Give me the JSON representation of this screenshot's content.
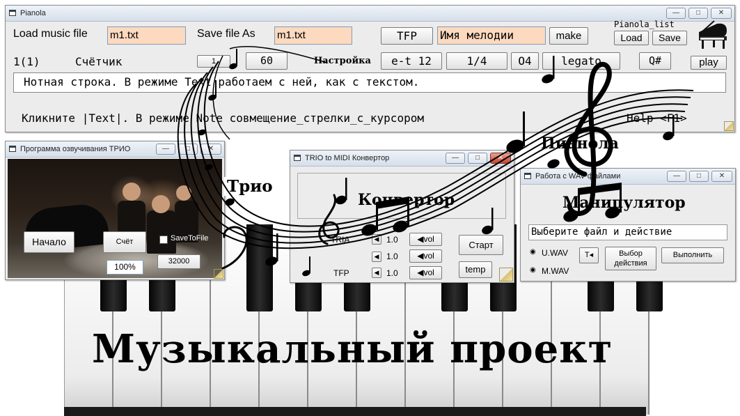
{
  "headline": "Музыкальный  проект",
  "pianola": {
    "title": "Pianola",
    "load_label": "Load music file",
    "load_value": "m1.txt",
    "save_label": "Save file As",
    "save_value": "m1.txt",
    "tfp_button": "TFP",
    "melody_name": "Имя мелодии",
    "make_button": "make",
    "pianola_list_label": "Pianola_list",
    "list_load": "Load",
    "list_save": "Save",
    "counter_text": "1(1)",
    "counter_label": "Счётчик",
    "counter_value": "1",
    "bpm_value": "60",
    "settings_label": "Настройка",
    "key_value": "e-t 12",
    "fraction_value": "1/4",
    "octave_value": "O4",
    "legato_value": "legato",
    "sharp_value": "Q#",
    "play_button": "play",
    "note_string": "Нотная строка. В режиме Text работаем с ней, как с текстом.",
    "hint_text": "Кликните |Text|. В режиме Note совмещение_стрелки_с_курсором",
    "help_text": "Help <F1>"
  },
  "trio": {
    "title": "Программа озвучивания ТРИО",
    "start_button": "Начало",
    "count_button": "Счёт",
    "save_to_file": "SaveToFile",
    "percent_value": "100%",
    "rate_value": "32000",
    "label": "Трио"
  },
  "converter": {
    "title": "TRIO to MIDI  Конвертор",
    "heading": "Конвертор",
    "row1_label": "TRIA",
    "row1_value": "1.0",
    "row2_value": "1.0",
    "row3_label": "TFP",
    "row3_value": "1.0",
    "vol_label": "vol",
    "start_button": "Старт",
    "temp_button": "temp"
  },
  "pianola_label": "Пианола",
  "wav": {
    "title": "Работа с WAV файлами",
    "heading": "Манипулятор",
    "status_text": "Выберите файл и действие",
    "option1": "U.WAV",
    "option2": "M.WAV",
    "arrow_button": "T◂",
    "choose_action": "Выбор действия",
    "execute_button": "Выполнить"
  },
  "colors": {
    "field_highlight": "#fcd9bf",
    "titlebar_blue": "#d6dfea",
    "close_red": "#c4452d"
  }
}
